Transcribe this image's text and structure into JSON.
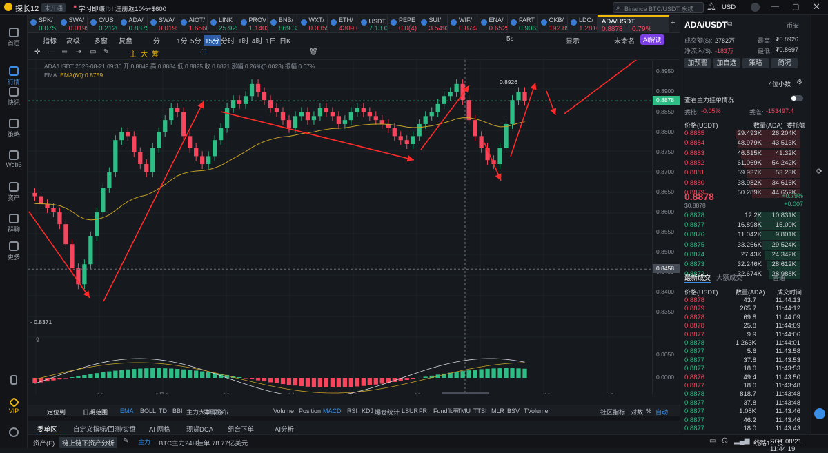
{
  "titlebar": {
    "app": "探长12",
    "status": "未开通",
    "promo": "学习即赚币! 注册返10%+$600",
    "search_placeholder": "Binance BTC/USDT 永续",
    "currency": "USD"
  },
  "nav": [
    "首页",
    "行情",
    "快讯",
    "策略",
    "Web3",
    "资产",
    "群聊",
    "更多",
    "VIP"
  ],
  "tickers": [
    {
      "n": "SPK/",
      "p": "0.07526",
      "dir": "up"
    },
    {
      "n": "SWA/",
      "p": "0.01959",
      "dir": "dn"
    },
    {
      "n": "C/US",
      "p": "0.21209",
      "dir": "up"
    },
    {
      "n": "ADA/",
      "p": "0.8875",
      "dir": "up"
    },
    {
      "n": "SWA/",
      "p": "0.01959",
      "dir": "dn"
    },
    {
      "n": "AIOT/",
      "p": "1.65605",
      "dir": "dn"
    },
    {
      "n": "LINK",
      "p": "25.925",
      "dir": "up"
    },
    {
      "n": "PROV",
      "p": "1.1402",
      "dir": "dn"
    },
    {
      "n": "BNB/",
      "p": "869.33",
      "dir": "up"
    },
    {
      "n": "WXT/",
      "p": "0.03551",
      "dir": "dn"
    },
    {
      "n": "ETH/",
      "p": "4309.63",
      "dir": "dn"
    },
    {
      "n": "USDT 场外",
      "p": "7.13 0.00%",
      "dir": "up"
    },
    {
      "n": "PEPE",
      "p": "0.0(4)10",
      "dir": "dn"
    },
    {
      "n": "SUI/",
      "p": "3.5492",
      "dir": "dn"
    },
    {
      "n": "WIF/",
      "p": "0.8744",
      "dir": "dn"
    },
    {
      "n": "ENA/",
      "p": "0.6525",
      "dir": "dn"
    },
    {
      "n": "FART",
      "p": "0.9062",
      "dir": "up"
    },
    {
      "n": "OKB/",
      "p": "192.89",
      "dir": "dn"
    },
    {
      "n": "LDO/",
      "p": "1.2816",
      "dir": "dn"
    }
  ],
  "active_ticker": {
    "n": "ADA/USDT",
    "p": "0.8878",
    "c": "0.79%"
  },
  "toolbar1": [
    "指标",
    "高级",
    "多窗",
    "复盘",
    "分",
    "1分",
    "5分",
    "15分",
    "分时",
    "1时",
    "4时",
    "1日",
    "日K",
    "5s",
    "显示",
    "未命名",
    "AI解读"
  ],
  "toolbar2": [
    "主",
    "大",
    "筹"
  ],
  "legend": {
    "line1": "ADA/USDT  2025-08-21 09:30  开 0.8849  高 0.8884  低 0.8825  收 0.8871  涨幅 0.26%(0.0023)  振幅 0.67%",
    "ema_label": "EMA",
    "ema_value": "EMA(60):0.8759"
  },
  "price_labels": [
    "0.8950",
    "0.8900",
    "0.8850",
    "0.8800",
    "0.8750",
    "0.8700",
    "0.8650",
    "0.8600",
    "0.8550",
    "0.8500",
    "0.8450",
    "0.8400",
    "0.8350",
    "0.0050",
    "0.0000",
    "-0.0050"
  ],
  "current_price": "0.8878",
  "cross_price": "0.8458",
  "high_mark": "0.8926",
  "low_mark": "0.8371",
  "time_labels": [
    "22",
    "8月21",
    "02",
    "04",
    "06",
    "08",
    "10",
    "12",
    "14"
  ],
  "cross_time": "2025-08-21 09:30",
  "macd_icon": "9",
  "indicators": [
    "定位到...",
    "日期范围",
    "EMA",
    "BOLL",
    "TD",
    "BBI",
    "主力大单跟踪",
    "筹码分布",
    "Volume",
    "Position",
    "MACD",
    "RSI",
    "KDJ",
    "爆仓统计",
    "LSUR",
    "FR",
    "Fundflow",
    "TTMU",
    "TTSI",
    "MLR",
    "BSV",
    "TVolume",
    "社区指标",
    "对数",
    "%",
    "自动"
  ],
  "bottom_tabs": [
    "委单区",
    "自定义指标/回测/实盘",
    "AI 网格",
    "现货DCA",
    "组合下单",
    "AI分析"
  ],
  "status": {
    "asset": "资产(F)",
    "chain": "链上链下资产分析",
    "main": "主力",
    "news": "BTC主力24H挂单 78.77亿美元",
    "line": "线路1：良",
    "time": "SGT 08/21 11:44:19"
  },
  "rp": {
    "pair": "ADA/USDT",
    "trade": "币安",
    "vol_l": "成交额($):",
    "vol_v": "2782万",
    "high_l": "最高:",
    "high_v": "₮0.8926",
    "net_l": "净流入($):",
    "net_v": "-183万",
    "low_l": "最低:",
    "low_v": "₮0.8697",
    "btns": [
      "加预警",
      "加自选",
      "策略",
      "简况"
    ],
    "decimals": "4位小数",
    "mm": "查看主力挂单情况",
    "diff_l": "委比:",
    "diff_v": "-0.05%",
    "gap_l": "委差:",
    "gap_v": "-153497.4",
    "headers": [
      "价格(USDT)",
      "数量(ADA)",
      "委托额"
    ],
    "asks": [
      [
        "0.8885",
        "29.493K",
        "26.204K"
      ],
      [
        "0.8884",
        "48.979K",
        "43.513K"
      ],
      [
        "0.8883",
        "46.515K",
        "41.32K"
      ],
      [
        "0.8882",
        "61.069K",
        "54.242K"
      ],
      [
        "0.8881",
        "59.937K",
        "53.23K"
      ],
      [
        "0.8880",
        "38.982K",
        "34.616K"
      ],
      [
        "0.8879",
        "50.289K",
        "44.652K"
      ]
    ],
    "last": "0.8878",
    "last_usd": "$0.8878",
    "chg_pct": "+0.79%",
    "chg_abs": "+0.007",
    "bids": [
      [
        "0.8878",
        "12.2K",
        "10.831K"
      ],
      [
        "0.8877",
        "16.898K",
        "15.00K"
      ],
      [
        "0.8876",
        "11.042K",
        "9.801K"
      ],
      [
        "0.8875",
        "33.266K",
        "29.524K"
      ],
      [
        "0.8874",
        "27.43K",
        "24.342K"
      ],
      [
        "0.8873",
        "32.246K",
        "28.612K"
      ],
      [
        "0.8872",
        "32.674K",
        "28.988K"
      ]
    ],
    "trade_tabs": [
      "最新成交",
      "大额成交",
      "普通"
    ],
    "trade_headers": [
      "价格(USDT)",
      "数量(ADA)",
      "成交时间"
    ],
    "trades": [
      [
        "0.8878",
        "43.7",
        "11:44:13",
        "dn"
      ],
      [
        "0.8879",
        "265.7",
        "11:44:12",
        "dn"
      ],
      [
        "0.8878",
        "69.8",
        "11:44:09",
        "dn"
      ],
      [
        "0.8878",
        "25.8",
        "11:44:09",
        "dn"
      ],
      [
        "0.8877",
        "9.9",
        "11:44:06",
        "dn"
      ],
      [
        "0.8878",
        "1.263K",
        "11:44:01",
        "up"
      ],
      [
        "0.8877",
        "5.6",
        "11:43:58",
        "up"
      ],
      [
        "0.8877",
        "37.8",
        "11:43:53",
        "up"
      ],
      [
        "0.8877",
        "18.0",
        "11:43:53",
        "up"
      ],
      [
        "0.8876",
        "49.4",
        "11:43:50",
        "dn"
      ],
      [
        "0.8877",
        "18.0",
        "11:43:48",
        "dn"
      ],
      [
        "0.8878",
        "818.7",
        "11:43:48",
        "up"
      ],
      [
        "0.8877",
        "37.8",
        "11:43:48",
        "up"
      ],
      [
        "0.8877",
        "1.08K",
        "11:43:46",
        "up"
      ],
      [
        "0.8877",
        "46.2",
        "11:43:46",
        "up"
      ],
      [
        "0.8877",
        "18.0",
        "11:43:43",
        "up"
      ]
    ],
    "side": [
      "下单"
    ]
  }
}
